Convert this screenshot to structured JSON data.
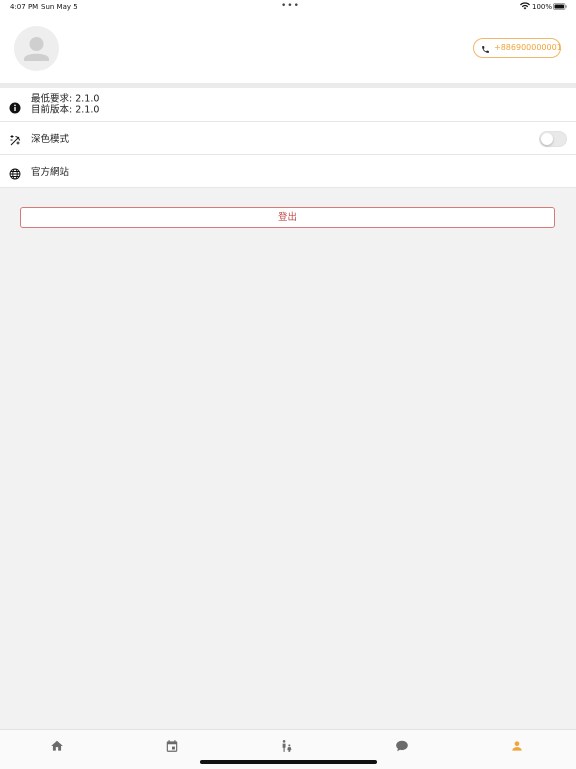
{
  "status_bar": {
    "time": "4:07 PM",
    "date": "Sun May 5",
    "battery_percent": "100%"
  },
  "profile": {
    "phone": "+886900000001"
  },
  "settings": {
    "version": {
      "min_required": "最低要求: 2.1.0",
      "current": "目前版本: 2.1.0"
    },
    "dark_mode": {
      "label": "深色模式",
      "enabled": false
    },
    "website": {
      "label": "官方網站"
    }
  },
  "logout_label": "登出",
  "tab_bar": {
    "tabs": [
      {
        "name": "home",
        "icon": "home-icon",
        "active": false
      },
      {
        "name": "calendar",
        "icon": "calendar-icon",
        "active": false
      },
      {
        "name": "family",
        "icon": "family-icon",
        "active": false
      },
      {
        "name": "chat",
        "icon": "chat-icon",
        "active": false
      },
      {
        "name": "profile",
        "icon": "person-icon",
        "active": true
      }
    ]
  },
  "colors": {
    "accent": "#f0a538",
    "logout": "#c0504d",
    "inactive_tab": "#6b6b6b"
  }
}
